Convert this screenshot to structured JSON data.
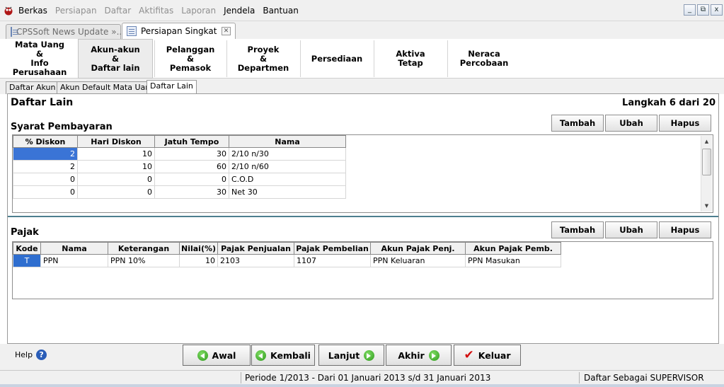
{
  "menu": {
    "items": [
      {
        "label": "Berkas",
        "enabled": true
      },
      {
        "label": "Persiapan",
        "enabled": false
      },
      {
        "label": "Daftar",
        "enabled": false
      },
      {
        "label": "Aktifitas",
        "enabled": false
      },
      {
        "label": "Laporan",
        "enabled": false
      },
      {
        "label": "Jendela",
        "enabled": true
      },
      {
        "label": "Bantuan",
        "enabled": true
      }
    ],
    "window_buttons": [
      "_",
      "⧉",
      "x"
    ]
  },
  "doc_tabs": [
    {
      "label": "CPSSoft News Update »...",
      "active": false
    },
    {
      "label": "Persiapan Singkat",
      "active": true
    }
  ],
  "wizard_steps": [
    {
      "label": "Mata Uang\n&\nInfo Perusahaan",
      "selected": false
    },
    {
      "label": "Akun-akun\n&\nDaftar lain",
      "selected": true
    },
    {
      "label": "Pelanggan\n&\nPemasok",
      "selected": false
    },
    {
      "label": "Proyek\n&\nDepartmen",
      "selected": false
    },
    {
      "label": "Persediaan",
      "selected": false
    },
    {
      "label": "Aktiva\nTetap",
      "selected": false
    },
    {
      "label": "Neraca\nPercobaan",
      "selected": false
    }
  ],
  "inner_tabs": [
    {
      "label": "Daftar Akun",
      "active": false
    },
    {
      "label": "Akun Default Mata Uang",
      "active": false
    },
    {
      "label": "Daftar Lain",
      "active": true
    }
  ],
  "page": {
    "title": "Daftar Lain",
    "step_text": "Langkah 6 dari 20"
  },
  "syarat": {
    "label": "Syarat Pembayaran",
    "buttons": {
      "add": "Tambah",
      "edit": "Ubah",
      "delete": "Hapus"
    },
    "columns": [
      "% Diskon",
      "Hari Diskon",
      "Jatuh Tempo",
      "Nama"
    ],
    "rows": [
      [
        "2",
        "10",
        "30",
        "2/10 n/30"
      ],
      [
        "2",
        "10",
        "60",
        "2/10 n/60"
      ],
      [
        "0",
        "0",
        "0",
        "C.O.D"
      ],
      [
        "0",
        "0",
        "30",
        "Net 30"
      ]
    ]
  },
  "pajak": {
    "label": "Pajak",
    "buttons": {
      "add": "Tambah",
      "edit": "Ubah",
      "delete": "Hapus"
    },
    "columns": [
      "Kode",
      "Nama",
      "Keterangan",
      "Nilai(%)",
      "Pajak Penjualan",
      "Pajak Pembelian",
      "Akun Pajak Penj.",
      "Akun Pajak Pemb."
    ],
    "rows": [
      [
        "T",
        "PPN",
        "PPN 10%",
        "10",
        "2103",
        "1107",
        "PPN Keluaran",
        "PPN Masukan"
      ]
    ]
  },
  "nav": {
    "help": "Help",
    "first": "Awal",
    "back": "Kembali",
    "next": "Lanjut",
    "last": "Akhir",
    "exit": "Keluar"
  },
  "status": {
    "period": "Periode 1/2013 - Dari 01 Januari 2013 s/d 31 Januari 2013",
    "user": "Daftar Sebagai SUPERVISOR"
  },
  "colors": {
    "selection": "#3a74d6",
    "divider": "#4d7f8f",
    "go_icon": "#2e9a1d",
    "exit_check": "#d20e0e"
  }
}
